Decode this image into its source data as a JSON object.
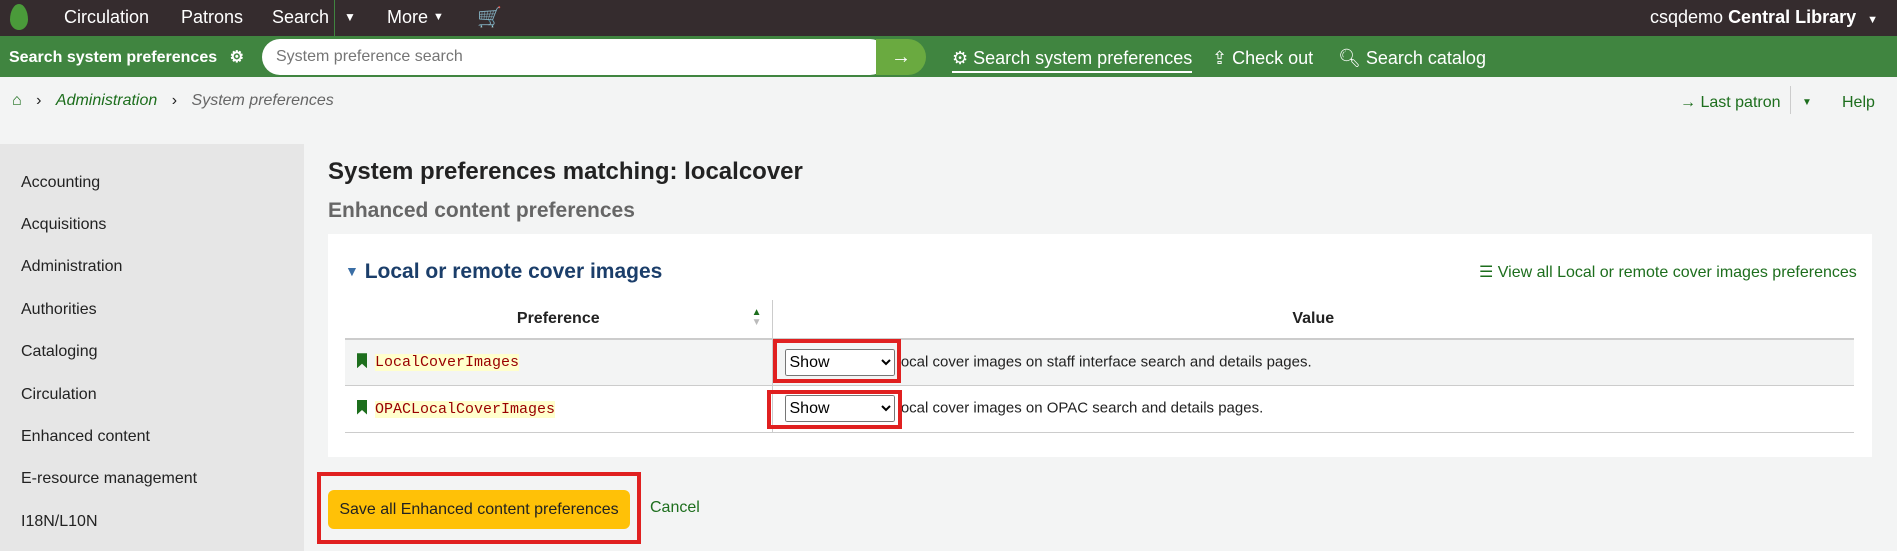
{
  "topnav": {
    "items": [
      "Circulation",
      "Patrons",
      "Search",
      "More"
    ],
    "user": "csqdemo",
    "library": "Central Library"
  },
  "searchbar": {
    "label": "Search system preferences",
    "placeholder": "System preference search",
    "links": [
      "Search system preferences",
      "Check out",
      "Search catalog"
    ]
  },
  "breadcrumb": {
    "items": [
      "Administration",
      "System preferences"
    ]
  },
  "rightlinks": {
    "last_patron": "Last patron",
    "help": "Help"
  },
  "sidebar": {
    "items": [
      "Accounting",
      "Acquisitions",
      "Administration",
      "Authorities",
      "Cataloging",
      "Circulation",
      "Enhanced content",
      "E-resource management",
      "I18N/L10N"
    ]
  },
  "main": {
    "title": "System preferences matching: localcover",
    "subtitle": "Enhanced content preferences",
    "section": "Local or remote cover images",
    "view_all": "View all Local or remote cover images preferences",
    "columns": [
      "Preference",
      "Value"
    ],
    "rows": [
      {
        "name": "LocalCoverImages",
        "value": "Show",
        "desc": "local cover images on staff interface search and details pages."
      },
      {
        "name": "OPACLocalCoverImages",
        "value": "Show",
        "desc": "local cover images on OPAC search and details pages."
      }
    ],
    "save": "Save all Enhanced content preferences",
    "cancel": "Cancel"
  },
  "colors": {
    "green": "#408540",
    "topbar": "#352c2e",
    "save": "#ffc107",
    "highlight": "#e02020"
  }
}
